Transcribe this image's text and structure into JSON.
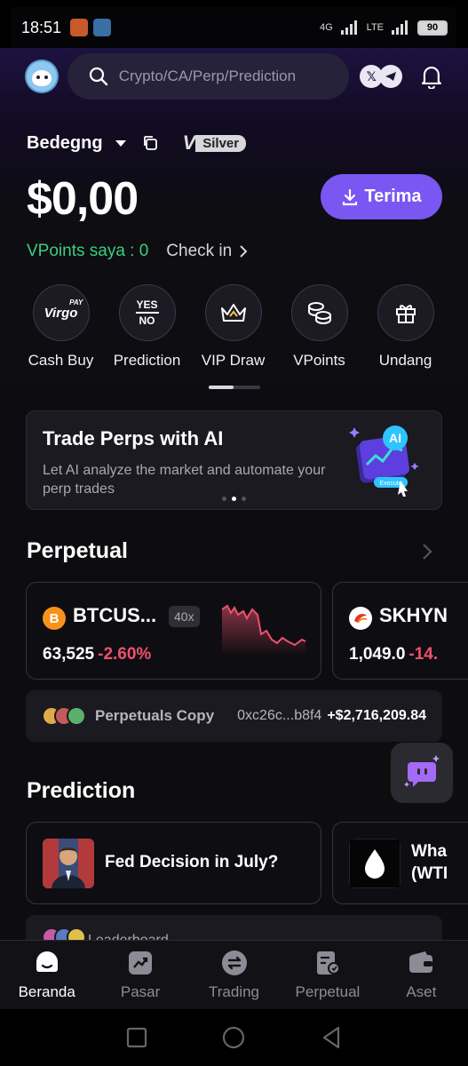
{
  "status_bar": {
    "time": "18:51",
    "network": "4G",
    "network2": "LTE",
    "battery": "90"
  },
  "header": {
    "search_placeholder": "Crypto/CA/Perp/Prediction"
  },
  "account": {
    "name": "Bedegng",
    "tier": "Silver",
    "tier_logo": "V",
    "balance": "$0,00",
    "receive_label": "Terima",
    "vpoints_label": "VPoints saya : 0",
    "checkin_label": "Check in"
  },
  "quick_actions": [
    {
      "label": "Cash Buy",
      "icon": "virgo-pay-icon"
    },
    {
      "label": "Prediction",
      "icon": "yes-no-icon"
    },
    {
      "label": "VIP Draw",
      "icon": "crown-icon"
    },
    {
      "label": "VPoints",
      "icon": "coins-icon"
    },
    {
      "label": "Undang",
      "icon": "gift-icon"
    }
  ],
  "quick_icon_text": {
    "virgo": "Virgo",
    "pay": "PAY",
    "yes": "YES",
    "no": "NO"
  },
  "banner": {
    "title": "Trade Perps with AI",
    "description": "Let AI analyze the market and automate your perp trades",
    "art_label": "AI",
    "art_button": "Execute"
  },
  "perpetual": {
    "title": "Perpetual",
    "cards": [
      {
        "symbol": "BTCUS...",
        "leverage": "40x",
        "price": "63,525",
        "change": "-2.60%",
        "coin_glyph": "B",
        "coin_color": "#f7931a"
      },
      {
        "symbol": "SKHYN",
        "price": "1,049.0",
        "change": "-14."
      }
    ],
    "copy": {
      "label": "Perpetuals Copy",
      "address": "0xc26c...b8f4",
      "amount": "+$2,716,209.84"
    }
  },
  "prediction": {
    "title": "Prediction",
    "cards": [
      {
        "question": "Fed Decision in July?"
      },
      {
        "question_line1": "Wha",
        "question_line2": "(WTI"
      }
    ],
    "leaderboard_label": "Leaderboard"
  },
  "tabs": [
    {
      "label": "Beranda",
      "active": true
    },
    {
      "label": "Pasar",
      "active": false
    },
    {
      "label": "Trading",
      "active": false
    },
    {
      "label": "Perpetual",
      "active": false
    },
    {
      "label": "Aset",
      "active": false
    }
  ],
  "colors": {
    "accent": "#7a56f2",
    "positive": "#39d07d",
    "negative": "#f0506e"
  }
}
